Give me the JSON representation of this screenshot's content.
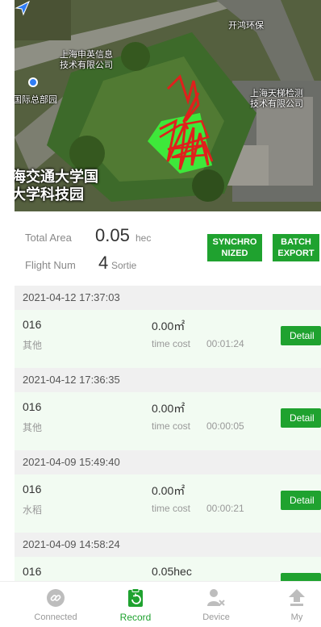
{
  "map": {
    "labels": [
      "开鸿环保",
      "上海申英信息\n技术有限公司",
      "上海天梯检测\n技术有限公司",
      "国际总部园"
    ],
    "campus": "海交通大学国\n大学科技园"
  },
  "summary": {
    "total_area_label": "Total Area",
    "total_area_value": "0.05",
    "total_area_unit": "hec",
    "flight_num_label": "Flight Num",
    "flight_num_value": "4",
    "flight_num_unit": "Sortie",
    "synchronized_label": "SYNCHRO\nNIZED",
    "batch_export_label": "BATCH\nEXPORT"
  },
  "records": [
    {
      "date": "2021-04-12 17:37:03",
      "id": "016",
      "crop": "其他",
      "area": "0.00㎡",
      "time_label": "time cost",
      "time": "00:01:24",
      "detail": "Detail"
    },
    {
      "date": "2021-04-12 17:36:35",
      "id": "016",
      "crop": "其他",
      "area": "0.00㎡",
      "time_label": "time cost",
      "time": "00:00:05",
      "detail": "Detail"
    },
    {
      "date": "2021-04-09 15:49:40",
      "id": "016",
      "crop": "水稻",
      "area": "0.00㎡",
      "time_label": "time cost",
      "time": "00:00:21",
      "detail": "Detail"
    },
    {
      "date": "2021-04-09 14:58:24",
      "id": "016",
      "crop": "",
      "area": "0.05hec",
      "time_label": "",
      "time": "",
      "detail": ""
    }
  ],
  "nav": [
    {
      "label": "Connected",
      "icon": "link-icon"
    },
    {
      "label": "Record",
      "icon": "clipboard-icon"
    },
    {
      "label": "Device",
      "icon": "device-icon"
    },
    {
      "label": "My",
      "icon": "upload-icon"
    }
  ],
  "colors": {
    "accent": "#1fa22f",
    "flight_path": "#e0201c",
    "sprayed_area": "#3ee83a"
  }
}
